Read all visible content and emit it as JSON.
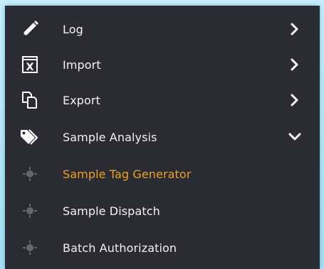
{
  "menu": {
    "items": [
      {
        "label": "Log",
        "icon": "pencil-icon",
        "expander": "chevron-right-icon"
      },
      {
        "label": "Import",
        "icon": "excel-icon",
        "expander": "chevron-right-icon"
      },
      {
        "label": "Export",
        "icon": "copy-icon",
        "expander": "chevron-right-icon"
      },
      {
        "label": "Sample Analysis",
        "icon": "tags-icon",
        "expander": "chevron-down-icon",
        "expanded": true
      }
    ],
    "subitems": [
      {
        "label": "Sample Tag Generator",
        "icon": "target-icon",
        "active": true
      },
      {
        "label": "Sample Dispatch",
        "icon": "target-icon",
        "active": false
      },
      {
        "label": "Batch Authorization",
        "icon": "target-icon",
        "active": false
      }
    ]
  },
  "colors": {
    "background": "#2b2c33",
    "text": "#f2f2f2",
    "active": "#f0a01e",
    "frame": "#bfe9f7"
  }
}
